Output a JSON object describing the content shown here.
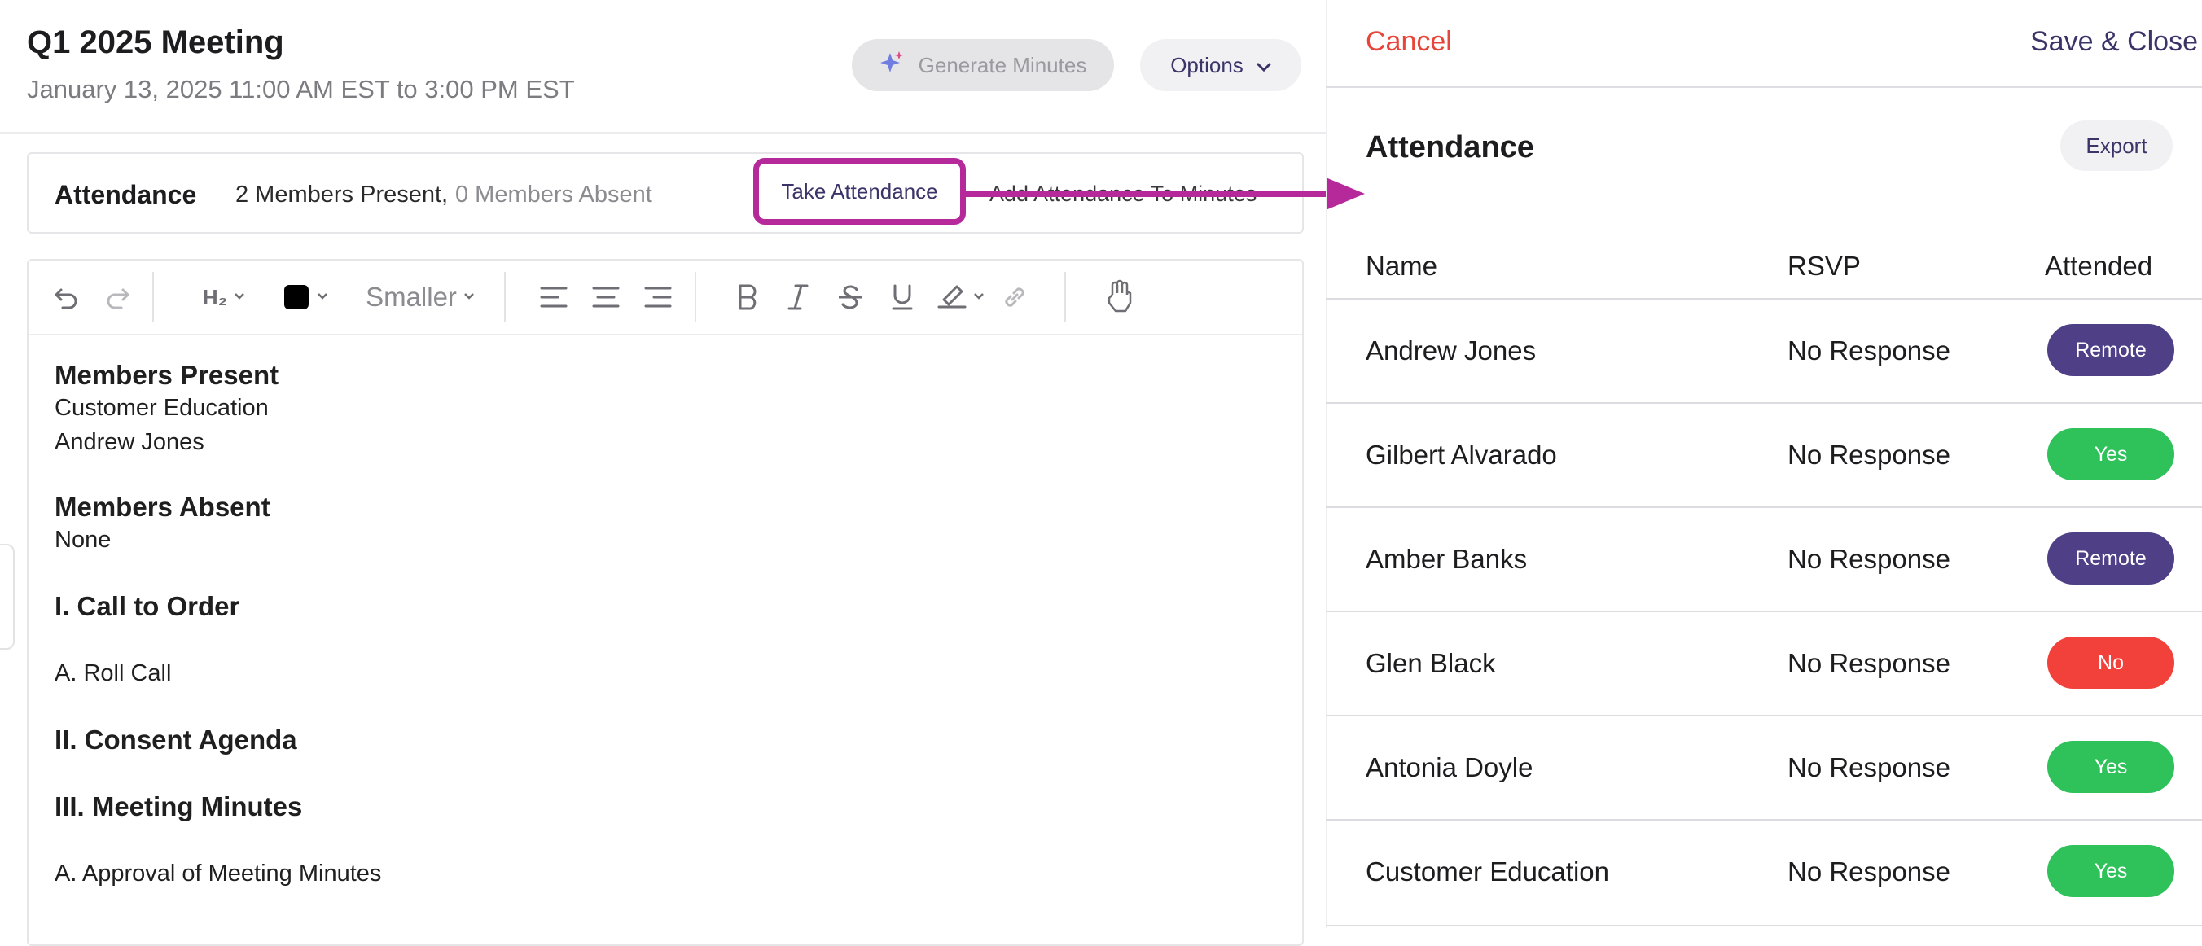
{
  "meeting": {
    "title": "Q1 2025 Meeting",
    "datetime": "January 13, 2025 11:00 AM EST to 3:00 PM EST"
  },
  "header_actions": {
    "generate_minutes": "Generate Minutes",
    "options": "Options"
  },
  "attendance_bar": {
    "label": "Attendance",
    "present": "2 Members Present,",
    "absent": "0 Members Absent",
    "take_attendance": "Take Attendance",
    "add_to_minutes": "Add Attendance To Minutes"
  },
  "toolbar": {
    "heading": "H₂",
    "font_size": "Smaller",
    "text_color": "#000000"
  },
  "content": {
    "members_present_heading": "Members Present",
    "members_present": [
      "Customer Education",
      "Andrew Jones"
    ],
    "members_absent_heading": "Members Absent",
    "members_absent": "None",
    "section1": "I. Call to Order",
    "item1": "A. Roll Call",
    "section2": "II. Consent Agenda",
    "section3": "III. Meeting Minutes",
    "item2": "A. Approval of Meeting Minutes"
  },
  "panel": {
    "cancel": "Cancel",
    "save_close": "Save & Close",
    "title": "Attendance",
    "export": "Export",
    "columns": {
      "name": "Name",
      "rsvp": "RSVP",
      "attended": "Attended"
    },
    "rows": [
      {
        "name": "Andrew Jones",
        "rsvp": "No Response",
        "attended": "Remote"
      },
      {
        "name": "Gilbert Alvarado",
        "rsvp": "No Response",
        "attended": "Yes"
      },
      {
        "name": "Amber Banks",
        "rsvp": "No Response",
        "attended": "Remote"
      },
      {
        "name": "Glen Black",
        "rsvp": "No Response",
        "attended": "No"
      },
      {
        "name": "Antonia Doyle",
        "rsvp": "No Response",
        "attended": "Yes"
      },
      {
        "name": "Customer Education",
        "rsvp": "No Response",
        "attended": "Yes"
      }
    ]
  },
  "colors": {
    "remote": "#4e3f86",
    "yes": "#2fc15a",
    "no": "#f2413a",
    "highlight": "#b5299b",
    "cancel": "#e8453a",
    "accent": "#3b3468"
  }
}
